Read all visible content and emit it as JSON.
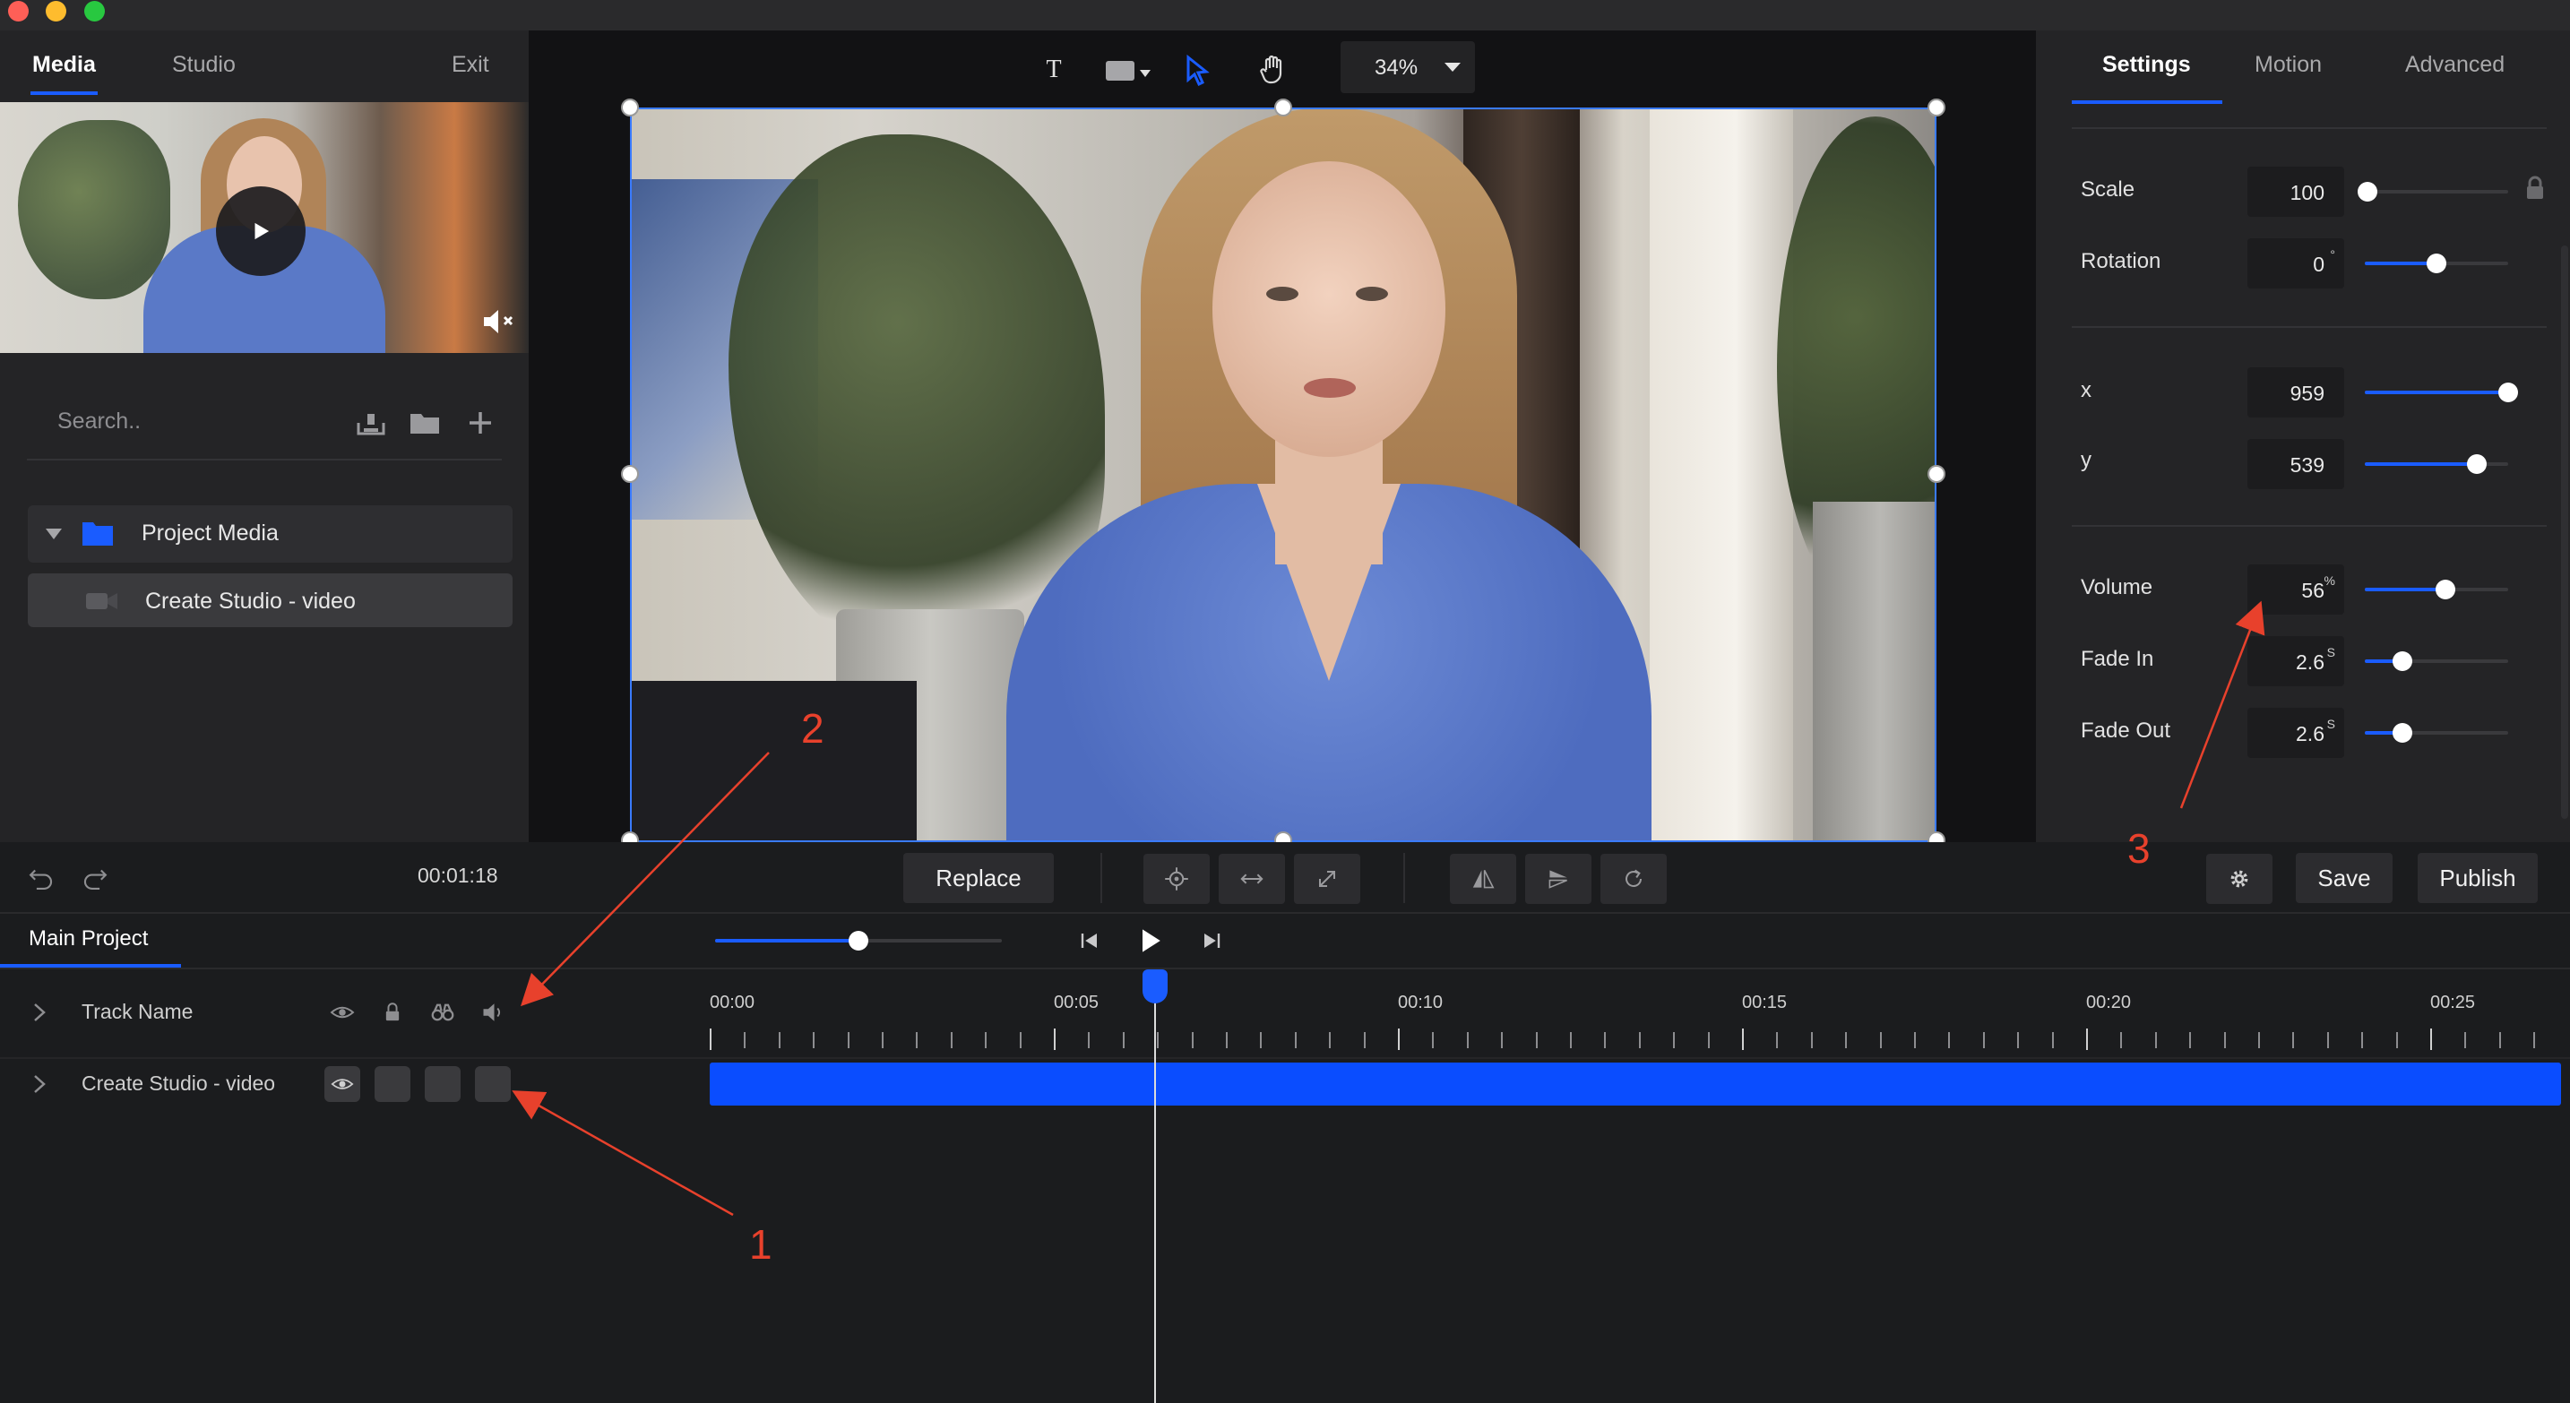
{
  "left_panel": {
    "tabs": [
      {
        "label": "Media",
        "active": true
      },
      {
        "label": "Studio",
        "active": false
      }
    ],
    "exit_label": "Exit",
    "search": {
      "placeholder": "Search..",
      "value": ""
    },
    "icons": [
      "upload-icon",
      "folder-icon",
      "plus-icon"
    ],
    "folder": {
      "label": "Project Media",
      "expanded": true
    },
    "items": [
      {
        "label": "Create Studio - video"
      }
    ]
  },
  "canvas": {
    "zoom": "34%",
    "tools": [
      "text-tool-icon",
      "shape-tool-icon",
      "select-tool-icon",
      "hand-tool-icon"
    ],
    "text_tool_glyph": "T"
  },
  "right_panel": {
    "tabs": [
      {
        "label": "Settings",
        "active": true
      },
      {
        "label": "Motion",
        "active": false
      },
      {
        "label": "Advanced",
        "active": false
      }
    ],
    "properties": {
      "scale": {
        "label": "Scale",
        "value": "100",
        "unit": "",
        "level": 0.02
      },
      "rotation": {
        "label": "Rotation",
        "value": "0",
        "unit": "°",
        "level": 0.5
      },
      "x": {
        "label": "x",
        "value": "959",
        "unit": "",
        "level": 1.0
      },
      "y": {
        "label": "y",
        "value": "539",
        "unit": "",
        "level": 0.78
      },
      "volume": {
        "label": "Volume",
        "value": "56",
        "unit": "%",
        "level": 0.56
      },
      "fade_in": {
        "label": "Fade In",
        "value": "2.6",
        "unit": "S",
        "level": 0.26
      },
      "fade_out": {
        "label": "Fade Out",
        "value": "2.6",
        "unit": "S",
        "level": 0.26
      }
    }
  },
  "control_bar": {
    "timecode": "00:01:18",
    "replace_label": "Replace",
    "save_label": "Save",
    "publish_label": "Publish"
  },
  "timeline": {
    "project_tab": "Main Project",
    "zoom_level": 0.5,
    "ruler_labels": [
      "00:00",
      "00:05",
      "00:10",
      "00:15",
      "00:20",
      "00:25"
    ],
    "playhead_time": "00:06",
    "tracks": [
      {
        "name": "Track Name"
      },
      {
        "name": "Create Studio - video"
      }
    ]
  },
  "annotations": {
    "one": "1",
    "two": "2",
    "three": "3",
    "color": "#e8412c"
  },
  "colors": {
    "accent": "#1a5cff",
    "clip": "#0a4dff",
    "background": "#1b1c1e",
    "panel": "#242426"
  }
}
